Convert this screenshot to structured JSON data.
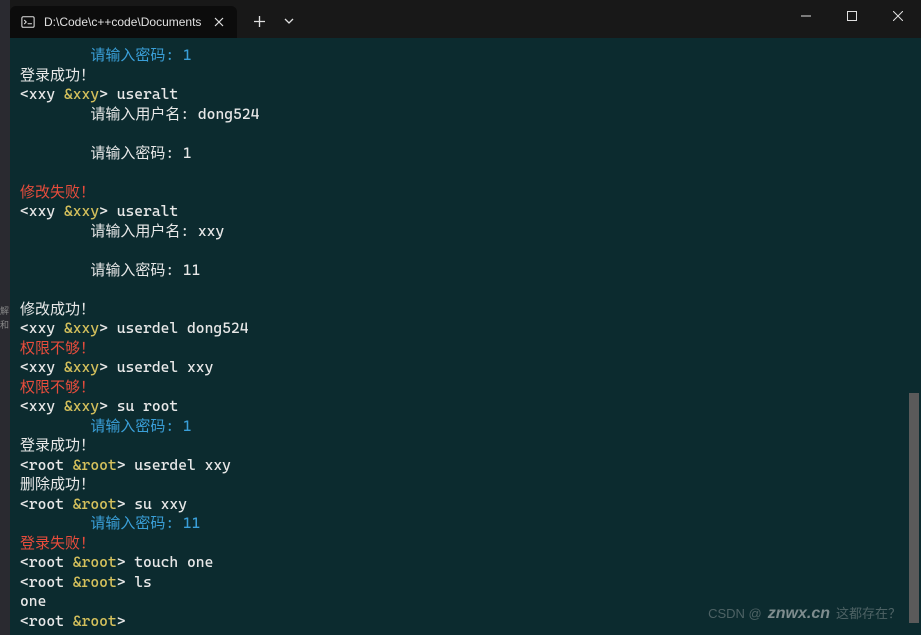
{
  "window": {
    "tab_title": "D:\\Code\\c++code\\Documents",
    "left_edge_hint": "解 和"
  },
  "terminal": {
    "lines": [
      {
        "segments": [
          {
            "text": "        请输入密码: 1",
            "cls": "c-blue"
          }
        ]
      },
      {
        "segments": [
          {
            "text": "登录成功！",
            "cls": "c-white"
          }
        ]
      },
      {
        "segments": [
          {
            "text": "<xxy ",
            "cls": "c-white"
          },
          {
            "text": "&xxy",
            "cls": "c-yellow"
          },
          {
            "text": "> useralt",
            "cls": "c-white"
          }
        ]
      },
      {
        "segments": [
          {
            "text": "        请输入用户名: dong524",
            "cls": "c-white"
          }
        ]
      },
      {
        "segments": [
          {
            "text": " ",
            "cls": "c-white"
          }
        ]
      },
      {
        "segments": [
          {
            "text": "        请输入密码: 1",
            "cls": "c-white"
          }
        ]
      },
      {
        "segments": [
          {
            "text": " ",
            "cls": "c-white"
          }
        ]
      },
      {
        "segments": [
          {
            "text": "修改失败！",
            "cls": "c-red"
          }
        ]
      },
      {
        "segments": [
          {
            "text": "<xxy ",
            "cls": "c-white"
          },
          {
            "text": "&xxy",
            "cls": "c-yellow"
          },
          {
            "text": "> useralt",
            "cls": "c-white"
          }
        ]
      },
      {
        "segments": [
          {
            "text": "        请输入用户名: xxy",
            "cls": "c-white"
          }
        ]
      },
      {
        "segments": [
          {
            "text": " ",
            "cls": "c-white"
          }
        ]
      },
      {
        "segments": [
          {
            "text": "        请输入密码: 11",
            "cls": "c-white"
          }
        ]
      },
      {
        "segments": [
          {
            "text": " ",
            "cls": "c-white"
          }
        ]
      },
      {
        "segments": [
          {
            "text": "修改成功！",
            "cls": "c-white"
          }
        ]
      },
      {
        "segments": [
          {
            "text": "<xxy ",
            "cls": "c-white"
          },
          {
            "text": "&xxy",
            "cls": "c-yellow"
          },
          {
            "text": "> userdel dong524",
            "cls": "c-white"
          }
        ]
      },
      {
        "segments": [
          {
            "text": "权限不够！",
            "cls": "c-red"
          }
        ]
      },
      {
        "segments": [
          {
            "text": "<xxy ",
            "cls": "c-white"
          },
          {
            "text": "&xxy",
            "cls": "c-yellow"
          },
          {
            "text": "> userdel xxy",
            "cls": "c-white"
          }
        ]
      },
      {
        "segments": [
          {
            "text": "权限不够！",
            "cls": "c-red"
          }
        ]
      },
      {
        "segments": [
          {
            "text": "<xxy ",
            "cls": "c-white"
          },
          {
            "text": "&xxy",
            "cls": "c-yellow"
          },
          {
            "text": "> su root",
            "cls": "c-white"
          }
        ]
      },
      {
        "segments": [
          {
            "text": "        请输入密码: 1",
            "cls": "c-blue"
          }
        ]
      },
      {
        "segments": [
          {
            "text": "登录成功！",
            "cls": "c-white"
          }
        ]
      },
      {
        "segments": [
          {
            "text": "<root ",
            "cls": "c-white"
          },
          {
            "text": "&root",
            "cls": "c-yellow"
          },
          {
            "text": "> userdel xxy",
            "cls": "c-white"
          }
        ]
      },
      {
        "segments": [
          {
            "text": "删除成功！",
            "cls": "c-white"
          }
        ]
      },
      {
        "segments": [
          {
            "text": "<root ",
            "cls": "c-white"
          },
          {
            "text": "&root",
            "cls": "c-yellow"
          },
          {
            "text": "> su xxy",
            "cls": "c-white"
          }
        ]
      },
      {
        "segments": [
          {
            "text": "        请输入密码: 11",
            "cls": "c-blue"
          }
        ]
      },
      {
        "segments": [
          {
            "text": "登录失败！",
            "cls": "c-red"
          }
        ]
      },
      {
        "segments": [
          {
            "text": "<root ",
            "cls": "c-white"
          },
          {
            "text": "&root",
            "cls": "c-yellow"
          },
          {
            "text": "> touch one",
            "cls": "c-white"
          }
        ]
      },
      {
        "segments": [
          {
            "text": "<root ",
            "cls": "c-white"
          },
          {
            "text": "&root",
            "cls": "c-yellow"
          },
          {
            "text": "> ls",
            "cls": "c-white"
          }
        ]
      },
      {
        "segments": [
          {
            "text": "one",
            "cls": "c-white"
          }
        ]
      },
      {
        "segments": [
          {
            "text": "<root ",
            "cls": "c-white"
          },
          {
            "text": "&root",
            "cls": "c-yellow"
          },
          {
            "text": ">",
            "cls": "c-white"
          }
        ]
      }
    ]
  },
  "watermark": {
    "left": "CSDN @",
    "site": "znwx.cn",
    "right": "这都存在？"
  }
}
